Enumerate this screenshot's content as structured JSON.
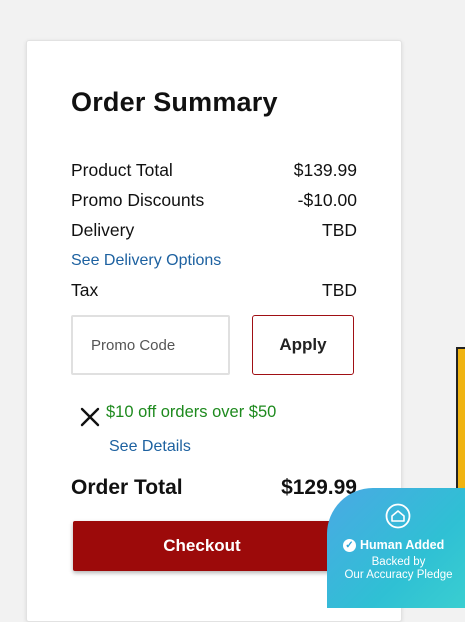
{
  "order_summary": {
    "title": "Order Summary",
    "rows": [
      {
        "label": "Product Total",
        "value": "$139.99"
      },
      {
        "label": "Promo Discounts",
        "value": "-$10.00"
      },
      {
        "label": "Delivery",
        "value": "TBD"
      },
      {
        "label": "Tax",
        "value": "TBD"
      }
    ],
    "delivery_options_link": "See Delivery Options",
    "promo": {
      "input_placeholder": "Promo Code",
      "apply_label": "Apply",
      "applied_text": "$10 off orders over $50",
      "details_link": "See Details",
      "remove_icon": "close-x-icon"
    },
    "total_label": "Order Total",
    "total_value": "$129.99",
    "checkout_label": "Checkout"
  },
  "badge": {
    "line1": "Human Added",
    "line2_a": "Backed by",
    "line2_b": "Our Accuracy Pledge",
    "icon": "house-shield-icon",
    "check_icon": "checkmark-icon"
  },
  "colors": {
    "accent_red": "#9c0a0a",
    "link_blue": "#1d61a0",
    "promo_green": "#1e8a1e",
    "badge_blue": "#4aa9e4"
  }
}
